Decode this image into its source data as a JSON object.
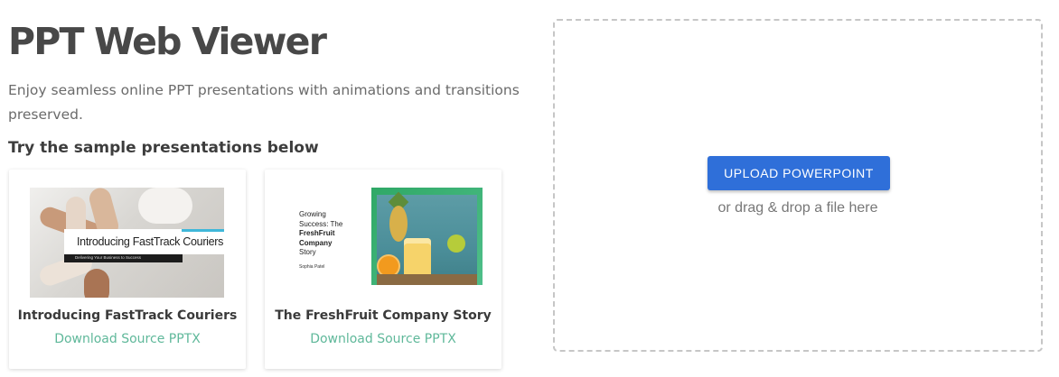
{
  "header": {
    "title": "PPT Web Viewer",
    "subtitle": "Enjoy seamless online PPT presentations with animations and transitions preserved.",
    "samples_heading": "Try the sample presentations below"
  },
  "samples": [
    {
      "name": "Introducing FastTrack Couriers",
      "download_label": "Download Source PPTX",
      "thumbnail": {
        "slide_title": "Introducing FastTrack Couriers",
        "slide_subtitle": "Delivering Your Business to Success"
      }
    },
    {
      "name": "The FreshFruit Company Story",
      "download_label": "Download Source PPTX",
      "thumbnail": {
        "title_line_1": "Growing",
        "title_line_2": "Success: The",
        "title_line_3": "FreshFruit",
        "title_line_4": "Company",
        "title_line_5": "Story",
        "author": "Sophia Patel"
      }
    }
  ],
  "upload": {
    "button_label": "UPLOAD POWERPOINT",
    "hint": "or drag & drop a file here"
  },
  "colors": {
    "accent_link": "#5fb89a",
    "upload_button": "#2f6fd9"
  }
}
